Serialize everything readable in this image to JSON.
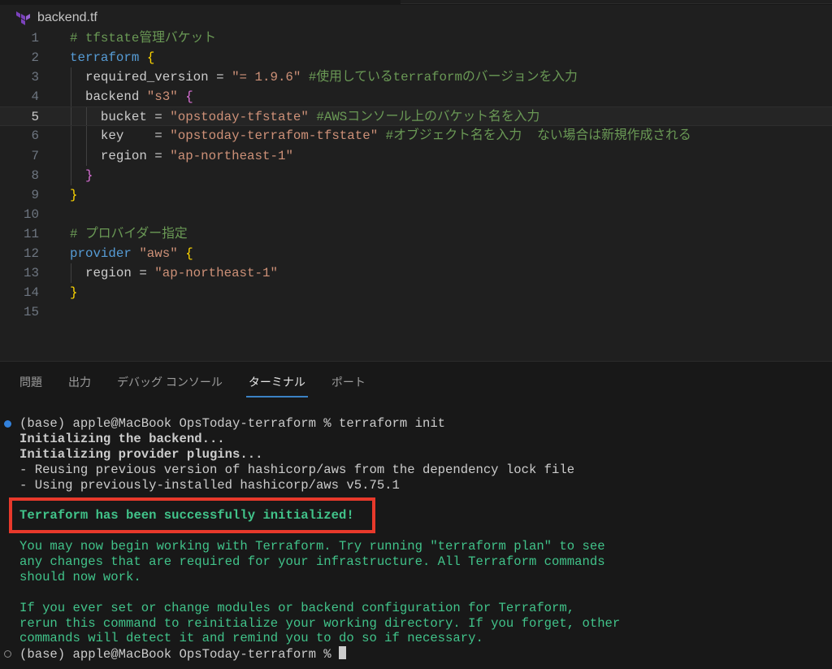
{
  "editor": {
    "tab_title": "backend.tf",
    "file_icon": "terraform-icon",
    "active_line": 5,
    "colors": {
      "comment": "#6a9955",
      "keyword": "#569cd6",
      "string": "#ce9178",
      "brace": "#ffd700",
      "brace_nested": "#da70d6",
      "plain": "#cccccc"
    },
    "lines": [
      {
        "n": "1",
        "indent": 0,
        "tokens": [
          {
            "t": "# tfstate管理バケット",
            "c": "comment"
          }
        ]
      },
      {
        "n": "2",
        "indent": 0,
        "tokens": [
          {
            "t": "terraform",
            "c": "kw"
          },
          {
            "t": " ",
            "c": "plain"
          },
          {
            "t": "{",
            "c": "brace"
          }
        ]
      },
      {
        "n": "3",
        "indent": 1,
        "tokens": [
          {
            "t": "  required_version = ",
            "c": "plain"
          },
          {
            "t": "\"= 1.9.6\"",
            "c": "str"
          },
          {
            "t": " #使用しているterraformのバージョンを入力",
            "c": "comment"
          }
        ]
      },
      {
        "n": "4",
        "indent": 1,
        "tokens": [
          {
            "t": "  backend ",
            "c": "plain"
          },
          {
            "t": "\"s3\"",
            "c": "str"
          },
          {
            "t": " ",
            "c": "plain"
          },
          {
            "t": "{",
            "c": "brace2"
          }
        ]
      },
      {
        "n": "5",
        "indent": 2,
        "tokens": [
          {
            "t": "    bucket = ",
            "c": "plain"
          },
          {
            "t": "\"opstoday-tfstate\"",
            "c": "str"
          },
          {
            "t": " #AWSコンソール上のバケット名を入力",
            "c": "comment"
          }
        ]
      },
      {
        "n": "6",
        "indent": 2,
        "tokens": [
          {
            "t": "    key    = ",
            "c": "plain"
          },
          {
            "t": "\"opstoday-terrafom-tfstate\"",
            "c": "str"
          },
          {
            "t": " #オブジェクト名を入力  ない場合は新規作成される",
            "c": "comment"
          }
        ]
      },
      {
        "n": "7",
        "indent": 2,
        "tokens": [
          {
            "t": "    region = ",
            "c": "plain"
          },
          {
            "t": "\"ap-northeast-1\"",
            "c": "str"
          }
        ]
      },
      {
        "n": "8",
        "indent": 1,
        "tokens": [
          {
            "t": "  ",
            "c": "plain"
          },
          {
            "t": "}",
            "c": "brace2"
          }
        ]
      },
      {
        "n": "9",
        "indent": 0,
        "tokens": [
          {
            "t": "}",
            "c": "brace"
          }
        ]
      },
      {
        "n": "10",
        "indent": 0,
        "tokens": []
      },
      {
        "n": "11",
        "indent": 0,
        "tokens": [
          {
            "t": "# プロバイダー指定",
            "c": "comment"
          }
        ]
      },
      {
        "n": "12",
        "indent": 0,
        "tokens": [
          {
            "t": "provider",
            "c": "kw"
          },
          {
            "t": " ",
            "c": "plain"
          },
          {
            "t": "\"aws\"",
            "c": "str"
          },
          {
            "t": " ",
            "c": "plain"
          },
          {
            "t": "{",
            "c": "brace"
          }
        ]
      },
      {
        "n": "13",
        "indent": 1,
        "tokens": [
          {
            "t": "  region = ",
            "c": "plain"
          },
          {
            "t": "\"ap-northeast-1\"",
            "c": "str"
          }
        ]
      },
      {
        "n": "14",
        "indent": 0,
        "tokens": [
          {
            "t": "}",
            "c": "brace"
          }
        ]
      },
      {
        "n": "15",
        "indent": 0,
        "tokens": []
      }
    ]
  },
  "panel": {
    "tabs": [
      {
        "label": "問題",
        "active": false
      },
      {
        "label": "出力",
        "active": false
      },
      {
        "label": "デバッグ コンソール",
        "active": false
      },
      {
        "label": "ターミナル",
        "active": true
      },
      {
        "label": "ポート",
        "active": false
      }
    ],
    "highlight_color": "#e8392b",
    "terminal": [
      {
        "text": "(base) apple@MacBook OpsToday-terraform % terraform init",
        "style": "plain",
        "marker": "filled"
      },
      {
        "text": "Initializing the backend...",
        "style": "bold"
      },
      {
        "text": "Initializing provider plugins...",
        "style": "bold"
      },
      {
        "text": "- Reusing previous version of hashicorp/aws from the dependency lock file",
        "style": "plain"
      },
      {
        "text": "- Using previously-installed hashicorp/aws v5.75.1",
        "style": "plain"
      },
      {
        "text": "",
        "style": "plain"
      },
      {
        "text": "Terraform has been successfully initialized!",
        "style": "greenbold"
      },
      {
        "text": "",
        "style": "plain"
      },
      {
        "text": "You may now begin working with Terraform. Try running \"terraform plan\" to see",
        "style": "green"
      },
      {
        "text": "any changes that are required for your infrastructure. All Terraform commands",
        "style": "green"
      },
      {
        "text": "should now work.",
        "style": "green"
      },
      {
        "text": "",
        "style": "plain"
      },
      {
        "text": "If you ever set or change modules or backend configuration for Terraform,",
        "style": "green"
      },
      {
        "text": "rerun this command to reinitialize your working directory. If you forget, other",
        "style": "green"
      },
      {
        "text": "commands will detect it and remind you to do so if necessary.",
        "style": "green"
      },
      {
        "text": "(base) apple@MacBook OpsToday-terraform % ",
        "style": "plain",
        "marker": "hollow",
        "cursor": true
      }
    ]
  }
}
